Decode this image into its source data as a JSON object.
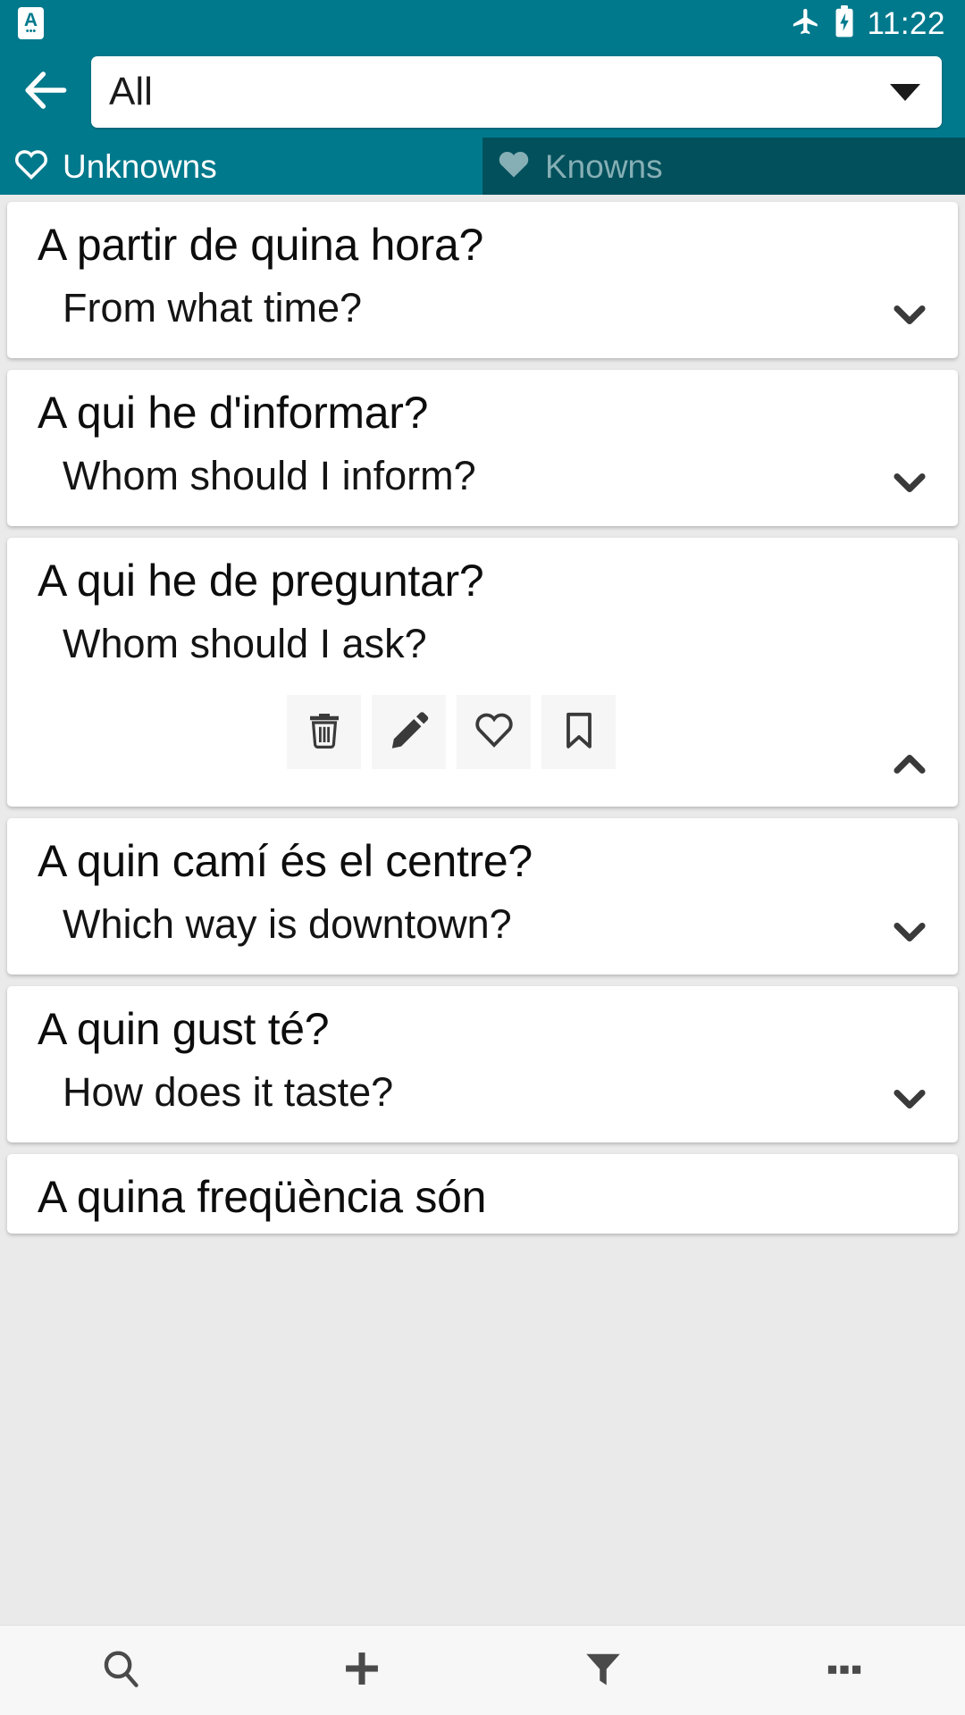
{
  "status_bar": {
    "app_icon": "app-letter-icon",
    "app_letter": "A",
    "app_dots": "•••",
    "airplane_icon": "airplane-mode-icon",
    "battery_icon": "battery-charging-icon",
    "time": "11:22"
  },
  "toolbar": {
    "back_icon": "back-arrow-icon",
    "spinner_value": "All",
    "spinner_caret_icon": "caret-down-icon"
  },
  "tabs": [
    {
      "label": "Unknowns",
      "icon": "heart-outline-icon",
      "active": true
    },
    {
      "label": "Knowns",
      "icon": "heart-filled-icon",
      "active": false
    }
  ],
  "cards": [
    {
      "term": "A partir de quina hora?",
      "definition": "From what time?",
      "expanded": false,
      "chevron_icon": "chevron-down-icon"
    },
    {
      "term": "A qui he d'informar?",
      "definition": "Whom should I inform?",
      "expanded": false,
      "chevron_icon": "chevron-down-icon"
    },
    {
      "term": "A qui he de preguntar?",
      "definition": "Whom should I ask?",
      "expanded": true,
      "chevron_icon": "chevron-up-icon",
      "actions": [
        {
          "name": "delete-button",
          "icon": "trash-icon"
        },
        {
          "name": "edit-button",
          "icon": "pencil-icon"
        },
        {
          "name": "favorite-button",
          "icon": "heart-outline-icon"
        },
        {
          "name": "bookmark-button",
          "icon": "bookmark-outline-icon"
        }
      ]
    },
    {
      "term": "A quin camí és el centre?",
      "definition": "Which way is downtown?",
      "expanded": false,
      "chevron_icon": "chevron-down-icon"
    },
    {
      "term": "A quin gust té?",
      "definition": "How does it taste?",
      "expanded": false,
      "chevron_icon": "chevron-down-icon"
    },
    {
      "term": "A quina freqüència són",
      "definition": "",
      "expanded": false,
      "chevron_icon": "chevron-down-icon"
    }
  ],
  "bottom_bar": [
    {
      "name": "search-button",
      "icon": "search-icon"
    },
    {
      "name": "add-button",
      "icon": "plus-icon"
    },
    {
      "name": "filter-button",
      "icon": "filter-funnel-icon"
    },
    {
      "name": "overflow-button",
      "icon": "more-horizontal-icon"
    }
  ],
  "colors": {
    "primary_teal": "#01798c",
    "dark_teal": "#01505c",
    "inactive_tab_text": "#86afb5",
    "card_background": "#ffffff",
    "list_background": "#eaeaea",
    "bottom_bar_background": "#f7f7f7",
    "icon_dark": "#3a3a3a"
  }
}
